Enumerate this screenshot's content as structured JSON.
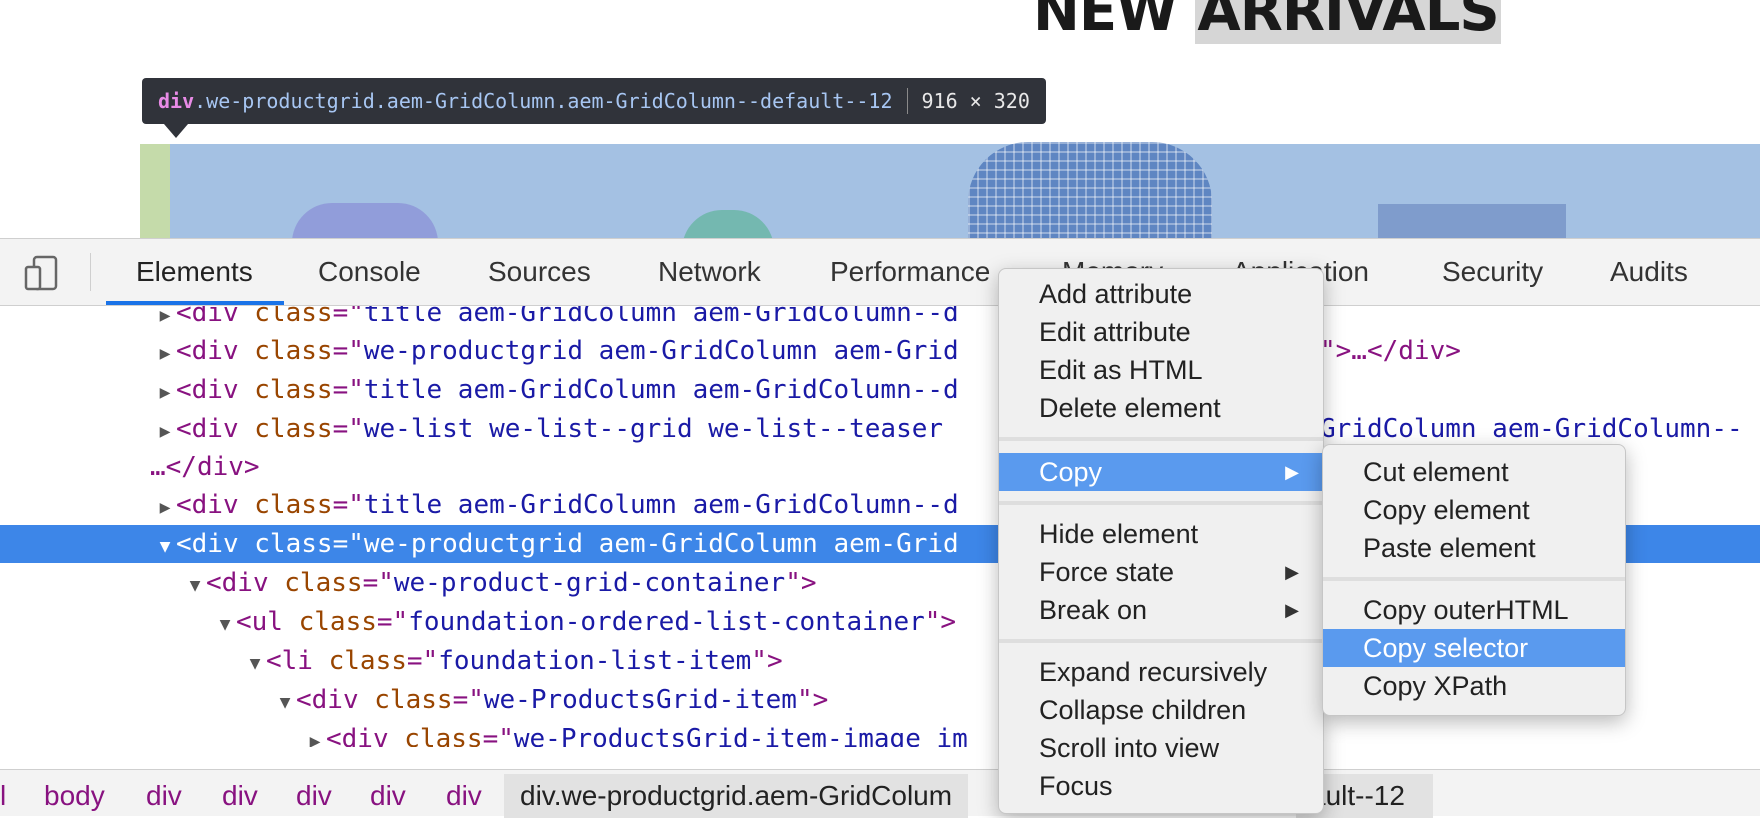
{
  "page": {
    "heading_part1": "NEW ",
    "heading_part2": "ARRIVALS"
  },
  "tooltip": {
    "tag": "div",
    "classes": ".we-productgrid.aem-GridColumn.aem-GridColumn--default--12",
    "size": "916 × 320"
  },
  "devtools": {
    "tabs": [
      "Elements",
      "Console",
      "Sources",
      "Network",
      "Performance",
      "Memory",
      "Application",
      "Security",
      "Audits"
    ],
    "active_tab": "Elements",
    "dom_lines": [
      {
        "tri": "▶",
        "tag": "div",
        "attr": "class",
        "value": "title aem-GridColumn aem-GridColumn--d",
        "tail": ""
      },
      {
        "tri": "▶",
        "tag": "div",
        "attr": "class",
        "value": "we-productgrid aem-GridColumn aem-Grid",
        "tail": "\">…</div>"
      },
      {
        "tri": "▶",
        "tag": "div",
        "attr": "class",
        "value": "title aem-GridColumn aem-GridColumn--d",
        "tail": ""
      },
      {
        "tri": "▶",
        "tag": "div",
        "attr": "class",
        "value": "we-list we-list--grid we-list--teaser",
        "tail": "GridColumn aem-GridColumn--"
      },
      {
        "tri": "",
        "tag": "",
        "attr": "",
        "value": "",
        "tail": "…</div>"
      },
      {
        "tri": "▶",
        "tag": "div",
        "attr": "class",
        "value": "title aem-GridColumn aem-GridColumn--d",
        "tail": ""
      },
      {
        "tri": "▼",
        "tag": "div",
        "attr": "class",
        "value": "we-productgrid aem-GridColumn aem-Grid",
        "tail": ""
      },
      {
        "tri": "▼",
        "tag": "div",
        "attr": "class",
        "value": "we-product-grid-container",
        "tail": "\">"
      },
      {
        "tri": "▼",
        "tag": "ul",
        "attr": "class",
        "value": "foundation-ordered-list-container",
        "tail": "\">"
      },
      {
        "tri": "▼",
        "tag": "li",
        "attr": "class",
        "value": "foundation-list-item",
        "tail": "\">"
      },
      {
        "tri": "▼",
        "tag": "div",
        "attr": "class",
        "value": "we-ProductsGrid-item",
        "tail": "\">"
      },
      {
        "tri": "▶",
        "tag": "div",
        "attr": "class",
        "value": "we-ProductsGrid-item-image im",
        "tail": ""
      }
    ],
    "breadcrumbs": [
      "l",
      "body",
      "div",
      "div",
      "div",
      "div",
      "div"
    ],
    "breadcrumb_active": "div.we-productgrid.aem-GridColum",
    "breadcrumb_tail": "ault--12"
  },
  "context_menu": {
    "items": [
      "Add attribute",
      "Edit attribute",
      "Edit as HTML",
      "Delete element",
      "Copy",
      "Hide element",
      "Force state",
      "Break on",
      "Expand recursively",
      "Collapse children",
      "Scroll into view",
      "Focus"
    ],
    "highlighted": "Copy"
  },
  "copy_submenu": {
    "items": [
      "Cut element",
      "Copy element",
      "Paste element",
      "Copy outerHTML",
      "Copy selector",
      "Copy XPath"
    ],
    "highlighted": "Copy selector"
  },
  "colors": {
    "selection": "#3d86e8",
    "menu_highlight": "#5a9aee",
    "inspect_overlay": "#a4c1e3",
    "tag_color": "#881280",
    "attr_name_color": "#994500",
    "attr_value_color": "#1a1aa6"
  }
}
